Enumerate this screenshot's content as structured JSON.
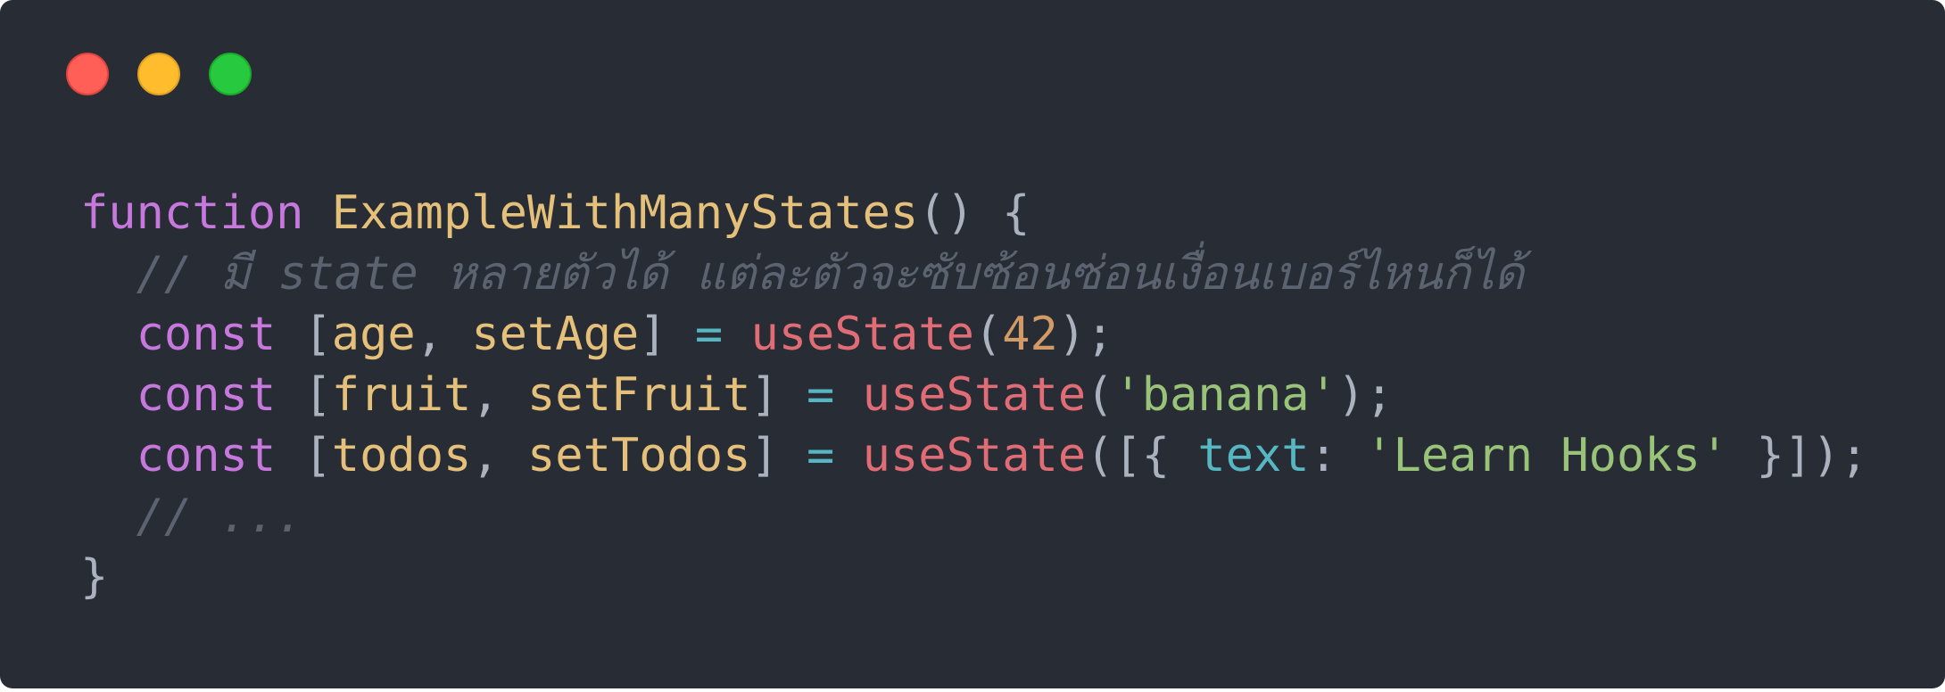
{
  "window": {
    "controls": {
      "close": "close",
      "minimize": "minimize",
      "zoom": "zoom"
    }
  },
  "code": {
    "line1": {
      "keyword": "function",
      "name": "ExampleWithManyStates",
      "punc": "() {"
    },
    "line2": {
      "comment": "// มี state หลายตัวได้ แต่ละตัวจะซับซ้อนซ่อนเงื่อนเบอร์ไหนก็ได้"
    },
    "line3": {
      "keyword": "const",
      "open": "[",
      "v1": "age",
      "sep": ",",
      "v2": "setAge",
      "close": "]",
      "eq": "=",
      "call": "useState",
      "lp": "(",
      "arg": "42",
      "end": ");"
    },
    "line4": {
      "keyword": "const",
      "open": "[",
      "v1": "fruit",
      "sep": ",",
      "v2": "setFruit",
      "close": "]",
      "eq": "=",
      "call": "useState",
      "lp": "(",
      "arg": "'banana'",
      "end": ");"
    },
    "line5": {
      "keyword": "const",
      "open": "[",
      "v1": "todos",
      "sep": ",",
      "v2": "setTodos",
      "close": "]",
      "eq": "=",
      "call": "useState",
      "lp": "([{",
      "prop": "text",
      "colon": ":",
      "arg": "'Learn Hooks'",
      "end": "}]);"
    },
    "line6": {
      "comment": "// ..."
    },
    "line7": {
      "punc": "}"
    }
  }
}
